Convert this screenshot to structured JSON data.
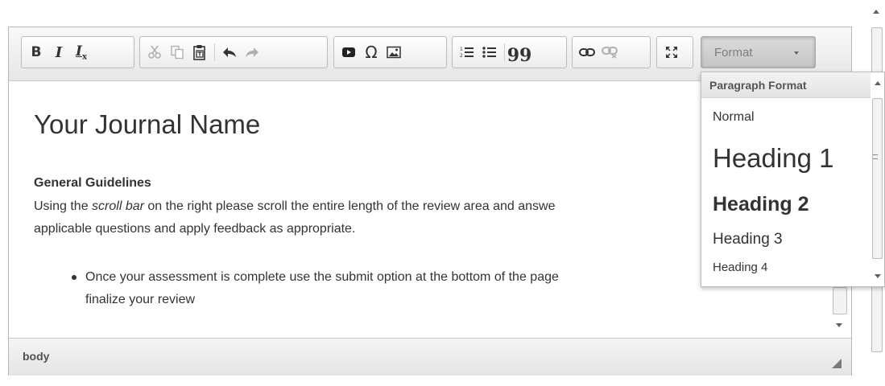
{
  "toolbar": {
    "buttons": [
      {
        "name": "bold-button",
        "icon": "bold-icon",
        "glyph": "B"
      },
      {
        "name": "italic-button",
        "icon": "italic-icon",
        "glyph": "I"
      },
      {
        "name": "remove-format-button",
        "icon": "remove-format-icon",
        "glyph": "Tx"
      },
      {
        "name": "cut-button",
        "icon": "cut-icon"
      },
      {
        "name": "copy-button",
        "icon": "copy-icon"
      },
      {
        "name": "paste-text-button",
        "icon": "paste-text-icon"
      },
      {
        "name": "undo-button",
        "icon": "undo-icon"
      },
      {
        "name": "redo-button",
        "icon": "redo-icon"
      },
      {
        "name": "media-embed-button",
        "icon": "media-icon"
      },
      {
        "name": "special-char-button",
        "icon": "omega-icon",
        "glyph": "Ω"
      },
      {
        "name": "image-button",
        "icon": "image-icon"
      },
      {
        "name": "numbered-list-button",
        "icon": "numbered-list-icon"
      },
      {
        "name": "bulleted-list-button",
        "icon": "bulleted-list-icon"
      },
      {
        "name": "blockquote-button",
        "icon": "quote-icon",
        "glyph": "99"
      },
      {
        "name": "link-button",
        "icon": "link-icon"
      },
      {
        "name": "unlink-button",
        "icon": "unlink-icon"
      },
      {
        "name": "maximize-button",
        "icon": "maximize-icon"
      }
    ],
    "format_label": "Format"
  },
  "content": {
    "title": "Your Journal Name",
    "guidelines_heading": "General Guidelines",
    "guidelines_text_before": "Using the ",
    "guidelines_text_italic": "scroll bar",
    "guidelines_text_after": " on the right please scroll the entire length of the review area and answe",
    "guidelines_text_line2": "applicable questions and apply feedback as appropriate.",
    "bullet_line1": "Once your assessment is complete use the submit option at the bottom of the page",
    "bullet_line2": "finalize your review"
  },
  "statusbar": {
    "path": "body"
  },
  "dropdown": {
    "header": "Paragraph Format",
    "items": [
      {
        "label": "Normal"
      },
      {
        "label": "Heading 1"
      },
      {
        "label": "Heading 2"
      },
      {
        "label": "Heading 3"
      },
      {
        "label": "Heading 4"
      }
    ]
  },
  "colors": {
    "text": "#333333",
    "toolbar_bg": "#ececec",
    "disabled_icon": "#b0b0b0"
  }
}
